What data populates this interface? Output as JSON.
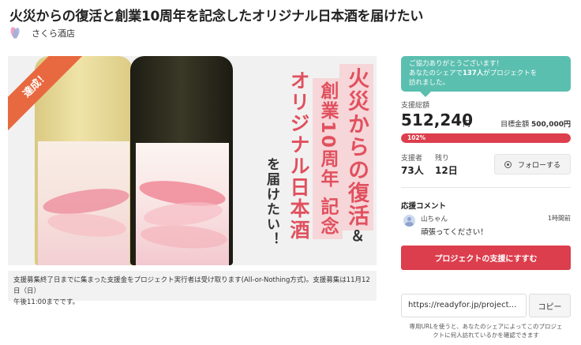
{
  "project": {
    "title": "火災からの復活と創業10周年を記念したオリジナル日本酒を届けたい",
    "owner_name": "さくら酒店"
  },
  "hero": {
    "ribbon": "達成！",
    "copy_line1": "火災からの復活",
    "copy_line2": "創業10周年 記念",
    "copy_amp": "＆",
    "copy_line3": "オリジナル日本酒",
    "copy_line4": "を届けたい！",
    "colors": {
      "ribbon": "#e8693f",
      "copy_red": "#e1505e",
      "copy_bg": "#f6d6d8"
    }
  },
  "notice": {
    "line1": "支援募集終了日までに集まった支援金をプロジェクト実行者は受け取ります(All-or-Nothing方式)。支援募集は11月12日（日）",
    "line2": "午後11:00までです。"
  },
  "share_bubble": {
    "line1": "ご協力ありがとうございます！",
    "line2_pre": "あなたのシェアで",
    "line2_count": "137人",
    "line2_post": "がプロジェクトを",
    "line3": "訪れました。"
  },
  "funding": {
    "total_label": "支援総額",
    "total_amount": "512,240",
    "total_unit": "円",
    "goal_label": "目標金額",
    "goal_amount": "500,000円",
    "progress_text": "102%",
    "progress_fraction": 1.0,
    "colors": {
      "bar": "#dc3e4d",
      "bubble": "#5bbfb0"
    }
  },
  "stats": {
    "supporters_label": "支援者",
    "supporters_value": "73人",
    "remaining_label": "残り",
    "remaining_value": "12日",
    "follow_label": "フォローする"
  },
  "comments": {
    "section_title": "応援コメント",
    "items": [
      {
        "name": "山ちゃん",
        "time": "1時間前",
        "text": "頑張ってください！"
      }
    ]
  },
  "actions": {
    "support_label": "プロジェクトの支援にすすむ",
    "share_url": "https://readyfor.jp/projects/r...",
    "copy_label": "コピー",
    "url_note_line1": "専用URLを使うと、あなたのシェアによってこのプロジェ",
    "url_note_line2": "クトに何人訪れているかを確認できます"
  }
}
